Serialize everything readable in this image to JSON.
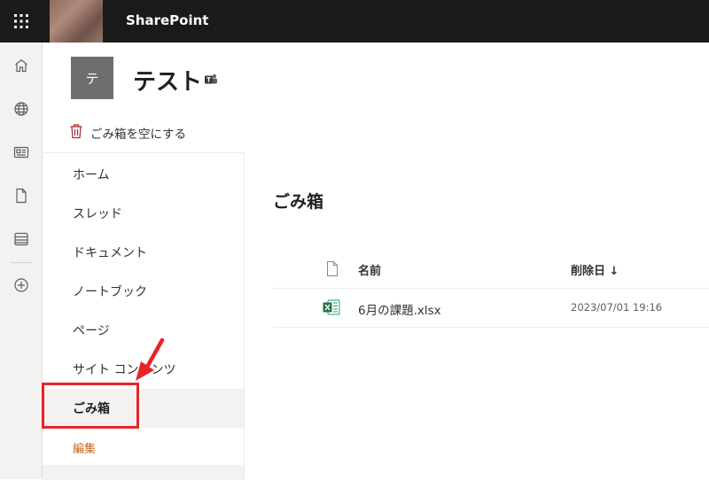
{
  "topbar": {
    "app_name": "SharePoint",
    "icons": [
      "waffle-icon"
    ]
  },
  "apprail": {
    "items": [
      "home-icon",
      "globe-icon",
      "news-icon",
      "file-icon",
      "lists-icon",
      "add-icon"
    ]
  },
  "site": {
    "logo_letter": "テ",
    "title": "テスト"
  },
  "command_bar": {
    "empty_recycle_bin_label": "ごみ箱を空にする"
  },
  "left_nav": {
    "items": [
      {
        "label": "ホーム"
      },
      {
        "label": "スレッド"
      },
      {
        "label": "ドキュメント"
      },
      {
        "label": "ノートブック"
      },
      {
        "label": "ページ"
      },
      {
        "label": "サイト コンテンツ"
      },
      {
        "label": "ごみ箱",
        "selected": true
      }
    ],
    "edit_label": "編集"
  },
  "main": {
    "title": "ごみ箱",
    "columns": {
      "name": "名前",
      "deleted_date": "削除日 ↓"
    },
    "rows": [
      {
        "name": "6月の課題.xlsx",
        "deleted_date": "2023/07/01 19:16",
        "icon": "excel-file-icon"
      }
    ]
  },
  "colors": {
    "topbar": "#1b1a19",
    "accent_annotation": "#e6242a",
    "trash_icon": "#a4262c",
    "edit_link": "#c4631b",
    "excel_green": "#217346"
  }
}
